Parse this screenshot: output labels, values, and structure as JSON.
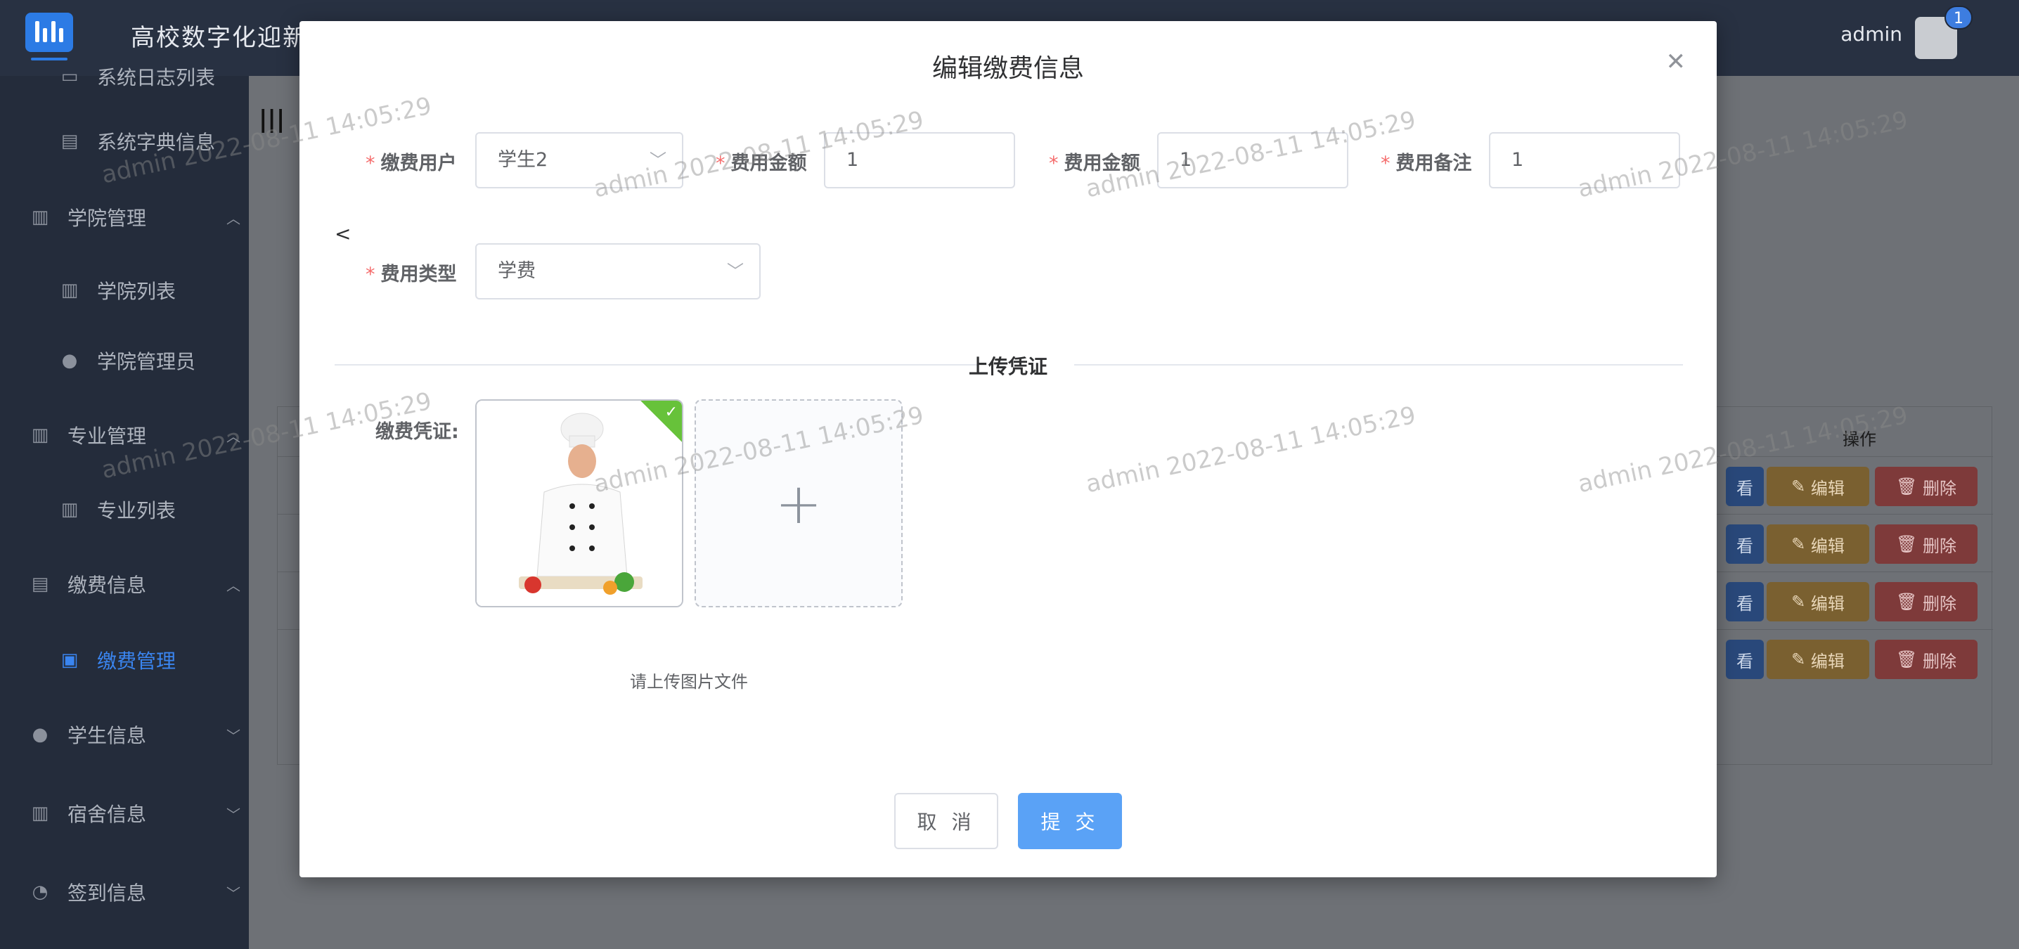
{
  "header": {
    "app_title": "高校数字化迎新",
    "user_name": "admin",
    "notification_count": "1"
  },
  "sidebar": {
    "items": [
      {
        "label": "系统日志列表",
        "icon": "list-icon",
        "level": "sub"
      },
      {
        "label": "系统字典信息",
        "icon": "card-icon",
        "level": "sub"
      },
      {
        "label": "学院管理",
        "icon": "building-icon",
        "level": "top",
        "expanded": true
      },
      {
        "label": "学院列表",
        "icon": "building-icon",
        "level": "sub"
      },
      {
        "label": "学院管理员",
        "icon": "user-icon",
        "level": "sub"
      },
      {
        "label": "专业管理",
        "icon": "building-icon",
        "level": "top",
        "expanded": true
      },
      {
        "label": "专业列表",
        "icon": "building-icon",
        "level": "sub"
      },
      {
        "label": "缴费信息",
        "icon": "card-icon",
        "level": "top",
        "expanded": true
      },
      {
        "label": "缴费管理",
        "icon": "chart-icon",
        "level": "sub",
        "active": true
      },
      {
        "label": "学生信息",
        "icon": "user-icon",
        "level": "top",
        "expanded": false
      },
      {
        "label": "宿舍信息",
        "icon": "building-icon",
        "level": "top",
        "expanded": false
      },
      {
        "label": "签到信息",
        "icon": "dashboard-icon",
        "level": "top",
        "expanded": false
      }
    ]
  },
  "background_table": {
    "op_header": "操作",
    "view_label": "看",
    "edit_label": "编辑",
    "delete_label": "删除",
    "row_count": 4
  },
  "dialog": {
    "title": "编辑缴费信息",
    "fields": {
      "payer": {
        "label": "缴费用户",
        "value": "学生2"
      },
      "amount1": {
        "label": "费用金额",
        "value": "1"
      },
      "amount2": {
        "label": "费用金额",
        "value": "1"
      },
      "remark": {
        "label": "费用备注",
        "value": "1"
      },
      "type": {
        "label": "费用类型",
        "value": "学费"
      }
    },
    "stray_char": "<",
    "divider_text": "上传凭证",
    "voucher_label": "缴费凭证:",
    "upload_tip": "请上传图片文件",
    "cancel_label": "取 消",
    "submit_label": "提 交"
  },
  "watermark": "admin 2022-08-11 14:05:29",
  "colors": {
    "primary": "#5aa2f6",
    "required": "#f56c6c",
    "success": "#67c23a",
    "sidebar_bg": "#242c3b",
    "active_menu": "#3a85f0"
  }
}
